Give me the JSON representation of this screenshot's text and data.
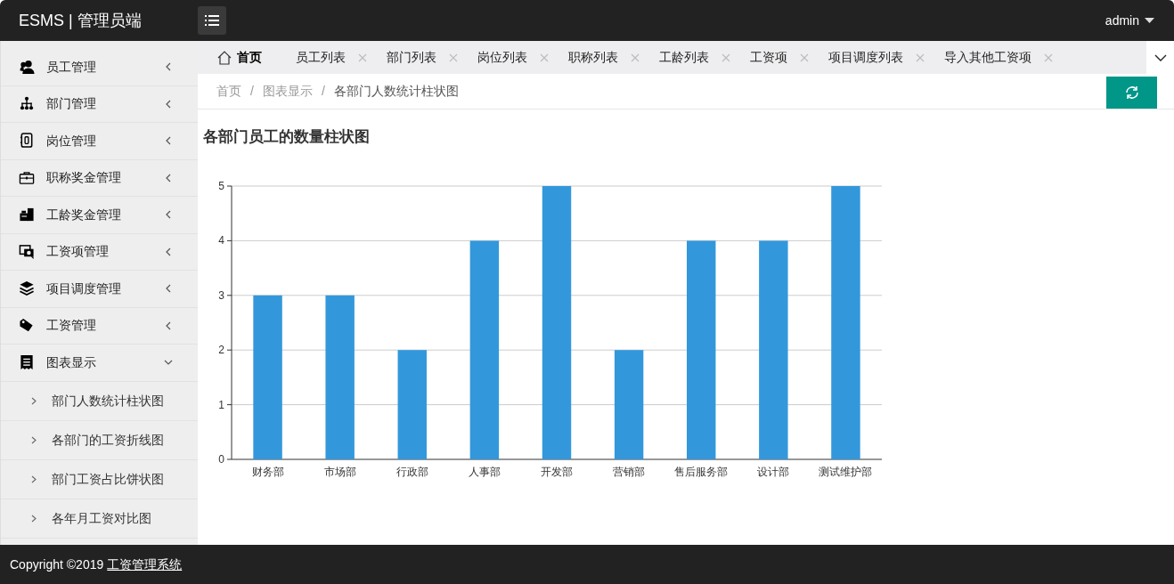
{
  "header": {
    "brand": "ESMS | 管理员端",
    "user": "admin"
  },
  "sidebar": {
    "items": [
      {
        "label": "员工管理",
        "expanded": false
      },
      {
        "label": "部门管理",
        "expanded": false
      },
      {
        "label": "岗位管理",
        "expanded": false
      },
      {
        "label": "职称奖金管理",
        "expanded": false
      },
      {
        "label": "工龄奖金管理",
        "expanded": false
      },
      {
        "label": "工资项管理",
        "expanded": false
      },
      {
        "label": "项目调度管理",
        "expanded": false
      },
      {
        "label": "工资管理",
        "expanded": false
      },
      {
        "label": "图表显示",
        "expanded": true,
        "children": [
          {
            "label": "部门人数统计柱状图"
          },
          {
            "label": "各部门的工资折线图"
          },
          {
            "label": "部门工资占比饼状图"
          },
          {
            "label": "各年月工资对比图"
          }
        ]
      }
    ]
  },
  "tabs": [
    {
      "label": "首页",
      "kind": "home",
      "selected": true
    },
    {
      "label": "员工列表",
      "kind": "closable",
      "selected": false
    },
    {
      "label": "部门列表",
      "kind": "closable",
      "selected": false
    },
    {
      "label": "岗位列表",
      "kind": "closable",
      "selected": false
    },
    {
      "label": "职称列表",
      "kind": "closable",
      "selected": false
    },
    {
      "label": "工龄列表",
      "kind": "closable",
      "selected": false
    },
    {
      "label": "工资项",
      "kind": "closable",
      "selected": false
    },
    {
      "label": "项目调度列表",
      "kind": "closable",
      "selected": false
    },
    {
      "label": "导入其他工资项",
      "kind": "closable",
      "selected": false
    }
  ],
  "breadcrumb": {
    "separator": "/",
    "items": [
      "首页",
      "图表显示",
      "各部门人数统计柱状图"
    ]
  },
  "panel": {
    "title": "各部门员工的数量柱状图",
    "chart_data": {
      "type": "bar",
      "categories": [
        "财务部",
        "市场部",
        "行政部",
        "人事部",
        "开发部",
        "营销部",
        "售后服务部",
        "设计部",
        "测试维护部"
      ],
      "series": [
        {
          "color": "#3398db",
          "values": [
            3,
            3,
            2,
            4,
            5,
            2,
            4,
            4,
            5
          ]
        }
      ],
      "ylim": [
        0,
        5
      ],
      "yticks": [
        0,
        1,
        2,
        3,
        4,
        5
      ],
      "grid": true
    }
  },
  "footer": {
    "text": "Copyright ©2019",
    "link": "工资管理系统"
  }
}
